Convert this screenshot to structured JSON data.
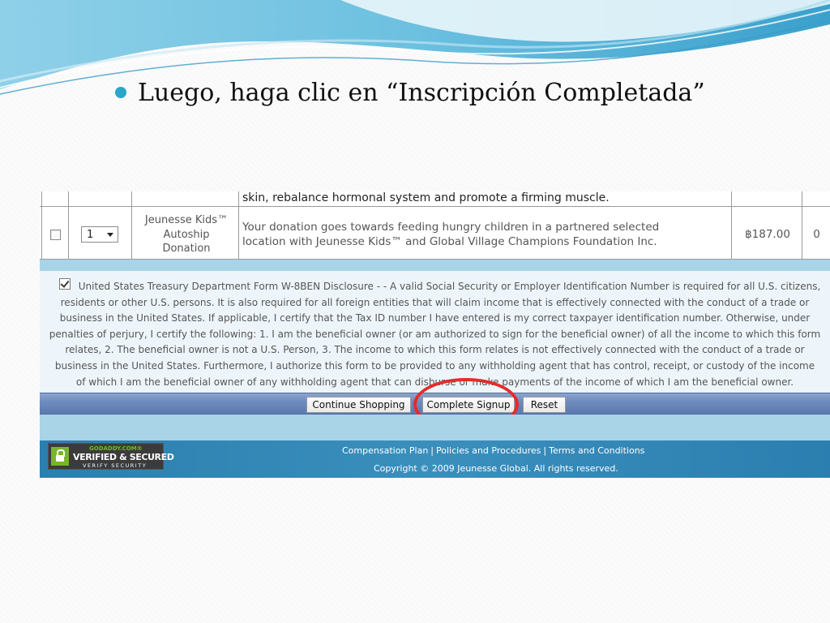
{
  "slide": {
    "instruction": "Luego, haga clic en “Inscripción Completada”",
    "accent_color": "#2aa6c8"
  },
  "table": {
    "previous_row_desc_tail": "skin, rebalance hormonal system and promote a firming muscle.",
    "row": {
      "quantity": "1",
      "name_lines": [
        "Jeunesse Kids™",
        "Autoship",
        "Donation"
      ],
      "desc_lines": [
        "Your donation goes towards feeding hungry children in a partnered selected",
        "location with Jeunesse Kids™ and Global Village Champions Foundation Inc."
      ],
      "price": "฿187.00",
      "pv": "0"
    }
  },
  "disclosure": {
    "checked": true,
    "lines": [
      "United States Treasury Department Form W-8BEN Disclosure - - A valid Social Security or Employer Identification Number is required for all U.S. citizens,",
      "residents or other U.S. persons. It is also required for all foreign entities that will claim income that is effectively connected with the conduct of a trade or",
      "business in the United States. If applicable, I certify that the Tax ID number I have entered is my correct taxpayer identification number. Otherwise, under",
      "penalties of perjury, I certify the following: 1. I am the beneficial owner (or am authorized to sign for the beneficial owner) of all the income to which this form",
      "relates, 2. The beneficial owner is not a U.S. Person, 3. The income to which this form relates is not effectively connected with the conduct of a trade or",
      "business in the United States. Furthermore, I authorize this form to be provided to any withholding agent that has control, receipt, or custody of the income",
      "of which I am the beneficial owner of any withholding agent that can disburse or make payments of the income of which I am the beneficial owner."
    ]
  },
  "buttons": {
    "continue_shopping": "Continue Shopping",
    "complete_signup": "Complete Signup",
    "reset": "Reset"
  },
  "highlight": {
    "color": "#e52b2b",
    "target": "complete_signup"
  },
  "footer": {
    "badge": {
      "brand": "GODADDY.COM®",
      "title": "VERIFIED & SECURED",
      "subtitle": "VERIFY SECURITY"
    },
    "links": [
      "Compensation Plan",
      "Policies and Procedures",
      "Terms and Conditions"
    ],
    "copyright": "Copyright © 2009 Jeunesse Global. All rights reserved."
  }
}
